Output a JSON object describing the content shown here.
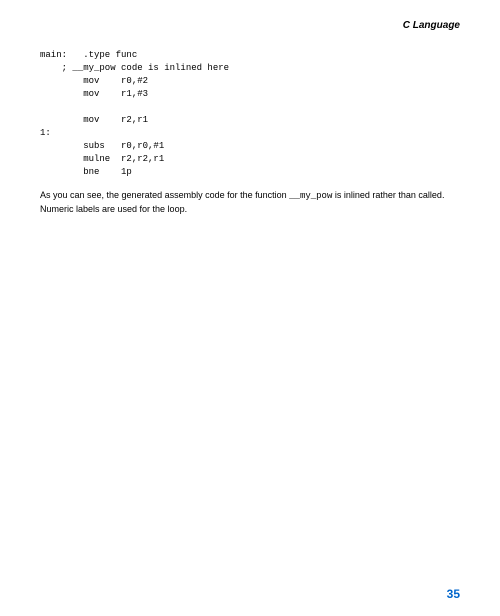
{
  "header": {
    "title": "C Language"
  },
  "code": {
    "line1": "main:   .type func",
    "line2": "    ; __my_pow code is inlined here",
    "line3": "        mov    r0,#2",
    "line4": "        mov    r1,#3",
    "line5": "",
    "line6": "        mov    r2,r1",
    "line7": "1:",
    "line8": "        subs   r0,r0,#1",
    "line9": "        mulne  r2,r2,r1",
    "line10": "        bne    1p"
  },
  "paragraph": {
    "part1": "As you can see, the generated assembly code for the function ",
    "inline_code": "__my_pow",
    "part2": " is inlined rather than called. Numeric labels are used for the loop."
  },
  "page_number": "35"
}
